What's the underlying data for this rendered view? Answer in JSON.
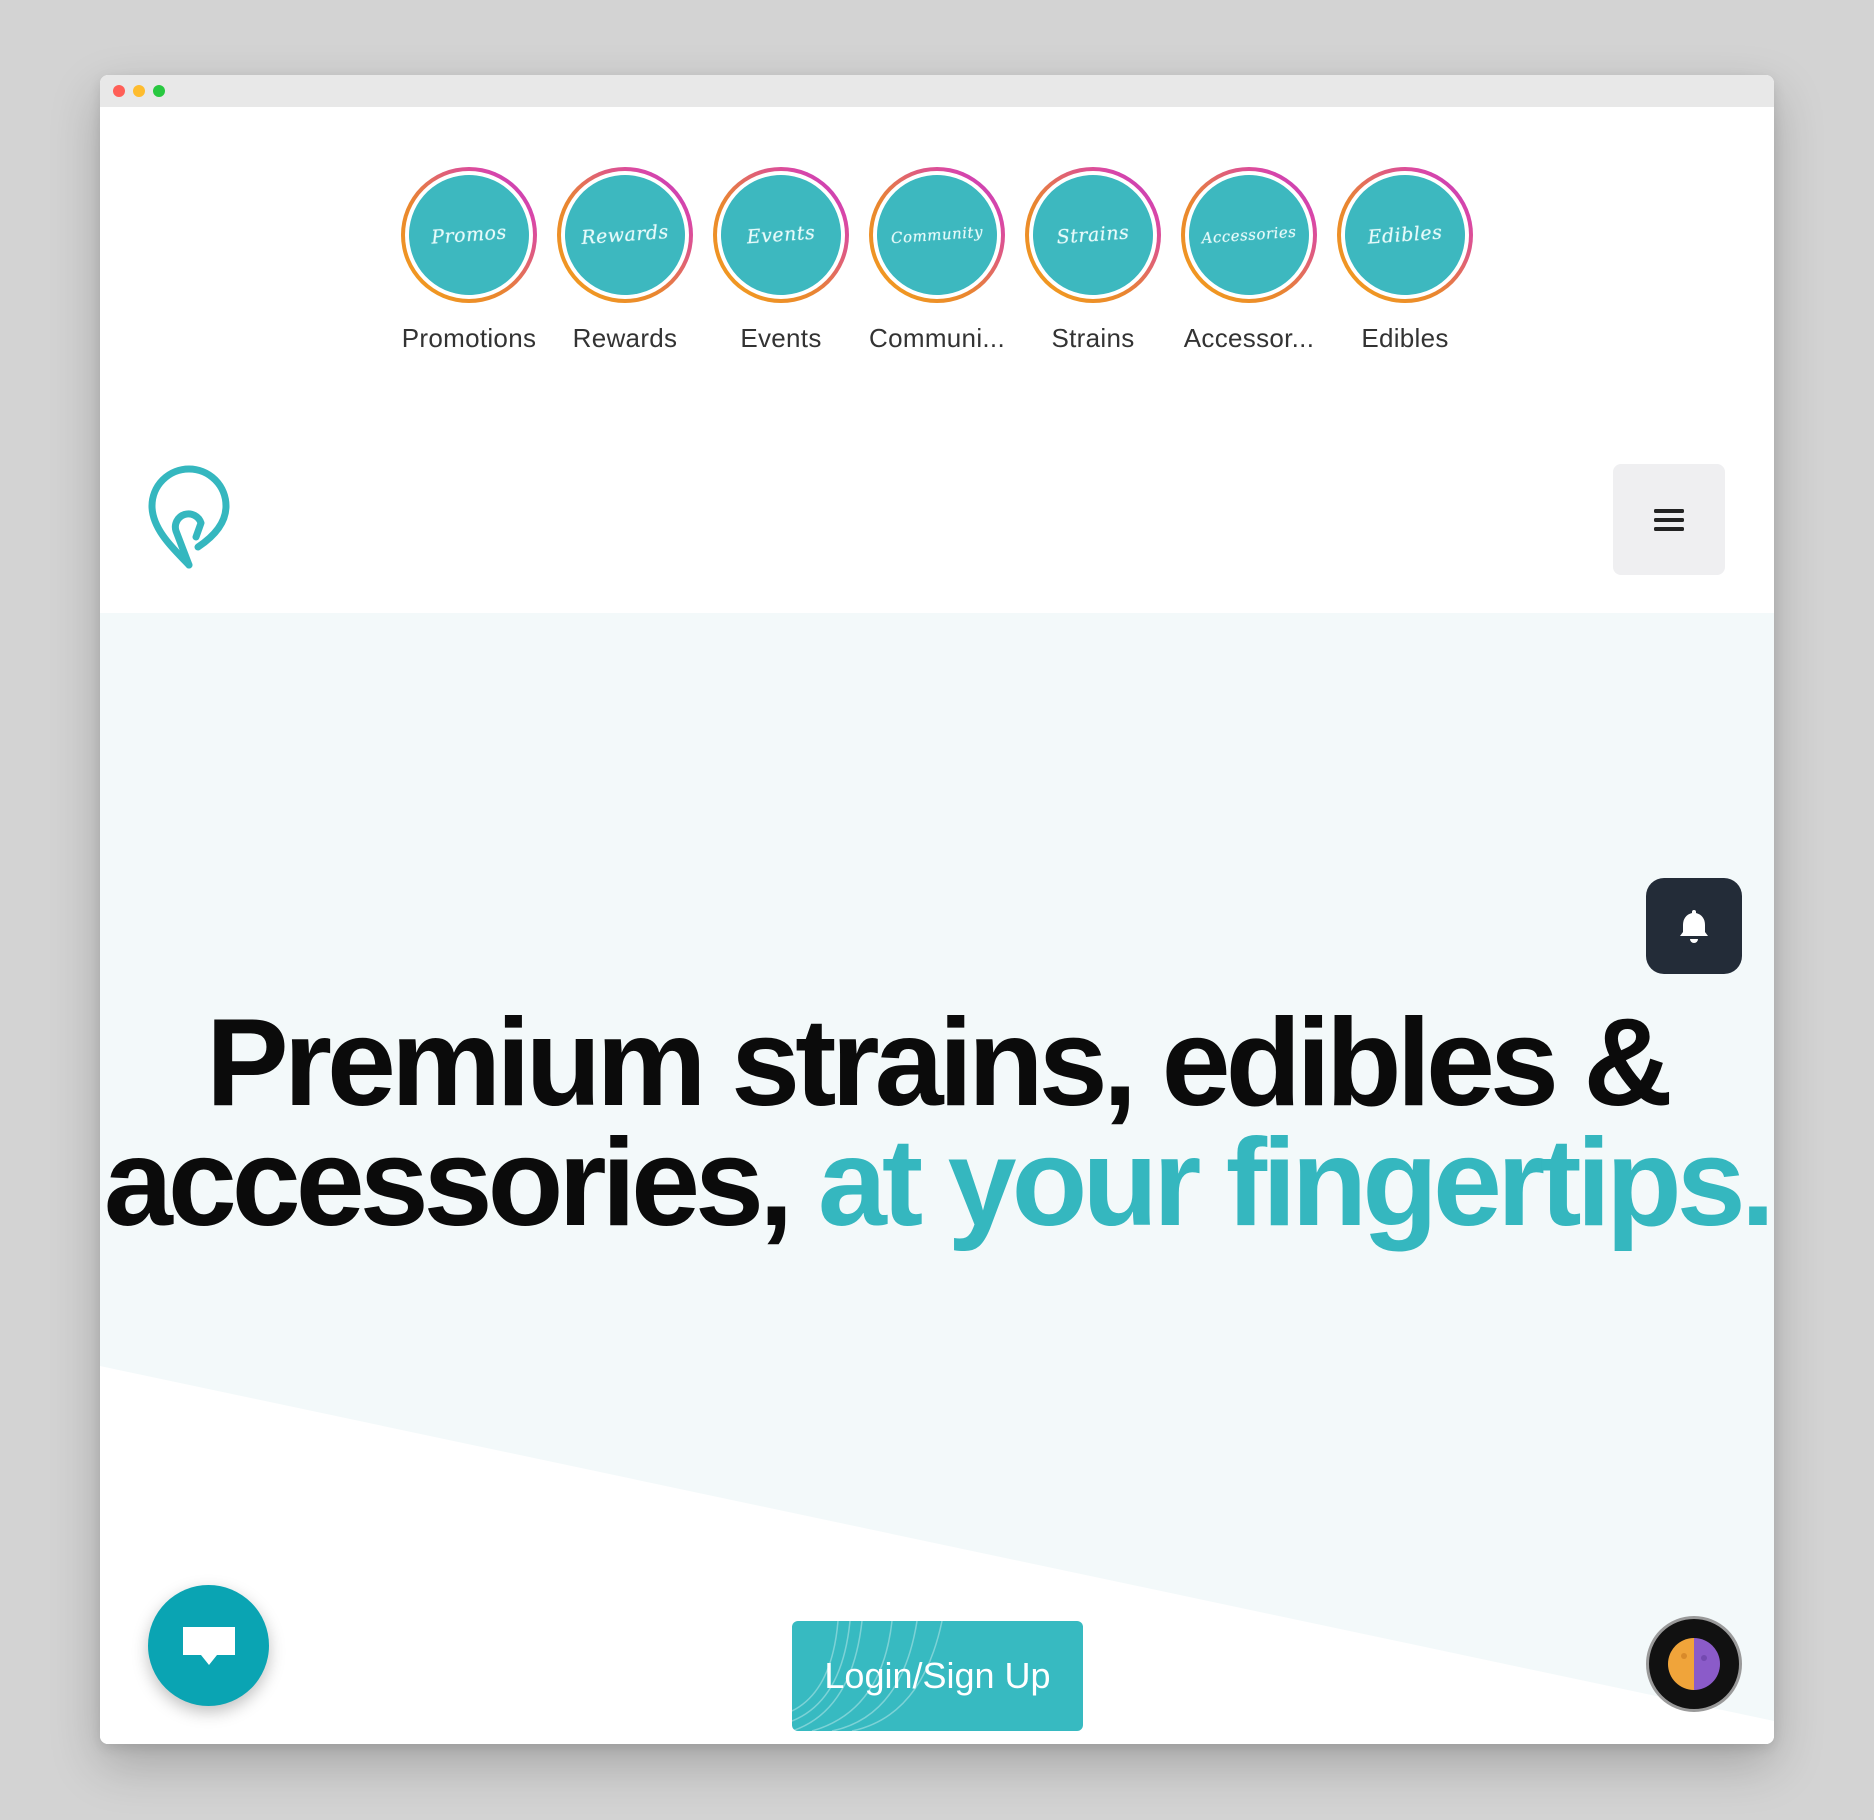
{
  "stories": [
    {
      "label": "Promotions",
      "bubble_text": "Promos"
    },
    {
      "label": "Rewards",
      "bubble_text": "Rewards"
    },
    {
      "label": "Events",
      "bubble_text": "Events"
    },
    {
      "label": "Communi...",
      "bubble_text": "Community"
    },
    {
      "label": "Strains",
      "bubble_text": "Strains"
    },
    {
      "label": "Accessor...",
      "bubble_text": "Accessories"
    },
    {
      "label": "Edibles",
      "bubble_text": "Edibles"
    }
  ],
  "header": {
    "logo_icon": "location-pin-logo",
    "menu_icon": "hamburger-menu"
  },
  "hero": {
    "headline_part1": "Premium strains, edibles & accessories,",
    "headline_accent": "at your fingertips.",
    "cta_label": "Login/Sign Up"
  },
  "widgets": {
    "notification_icon": "bell",
    "chat_icon": "chat-bubble",
    "theme_icon": "moon-sun-toggle"
  },
  "colors": {
    "accent": "#35b7bf",
    "story_bubble": "#3db8bf",
    "hero_bg": "#f3f9fa",
    "bell_bg": "#232c38",
    "chat_bg": "#0aa4b3"
  }
}
